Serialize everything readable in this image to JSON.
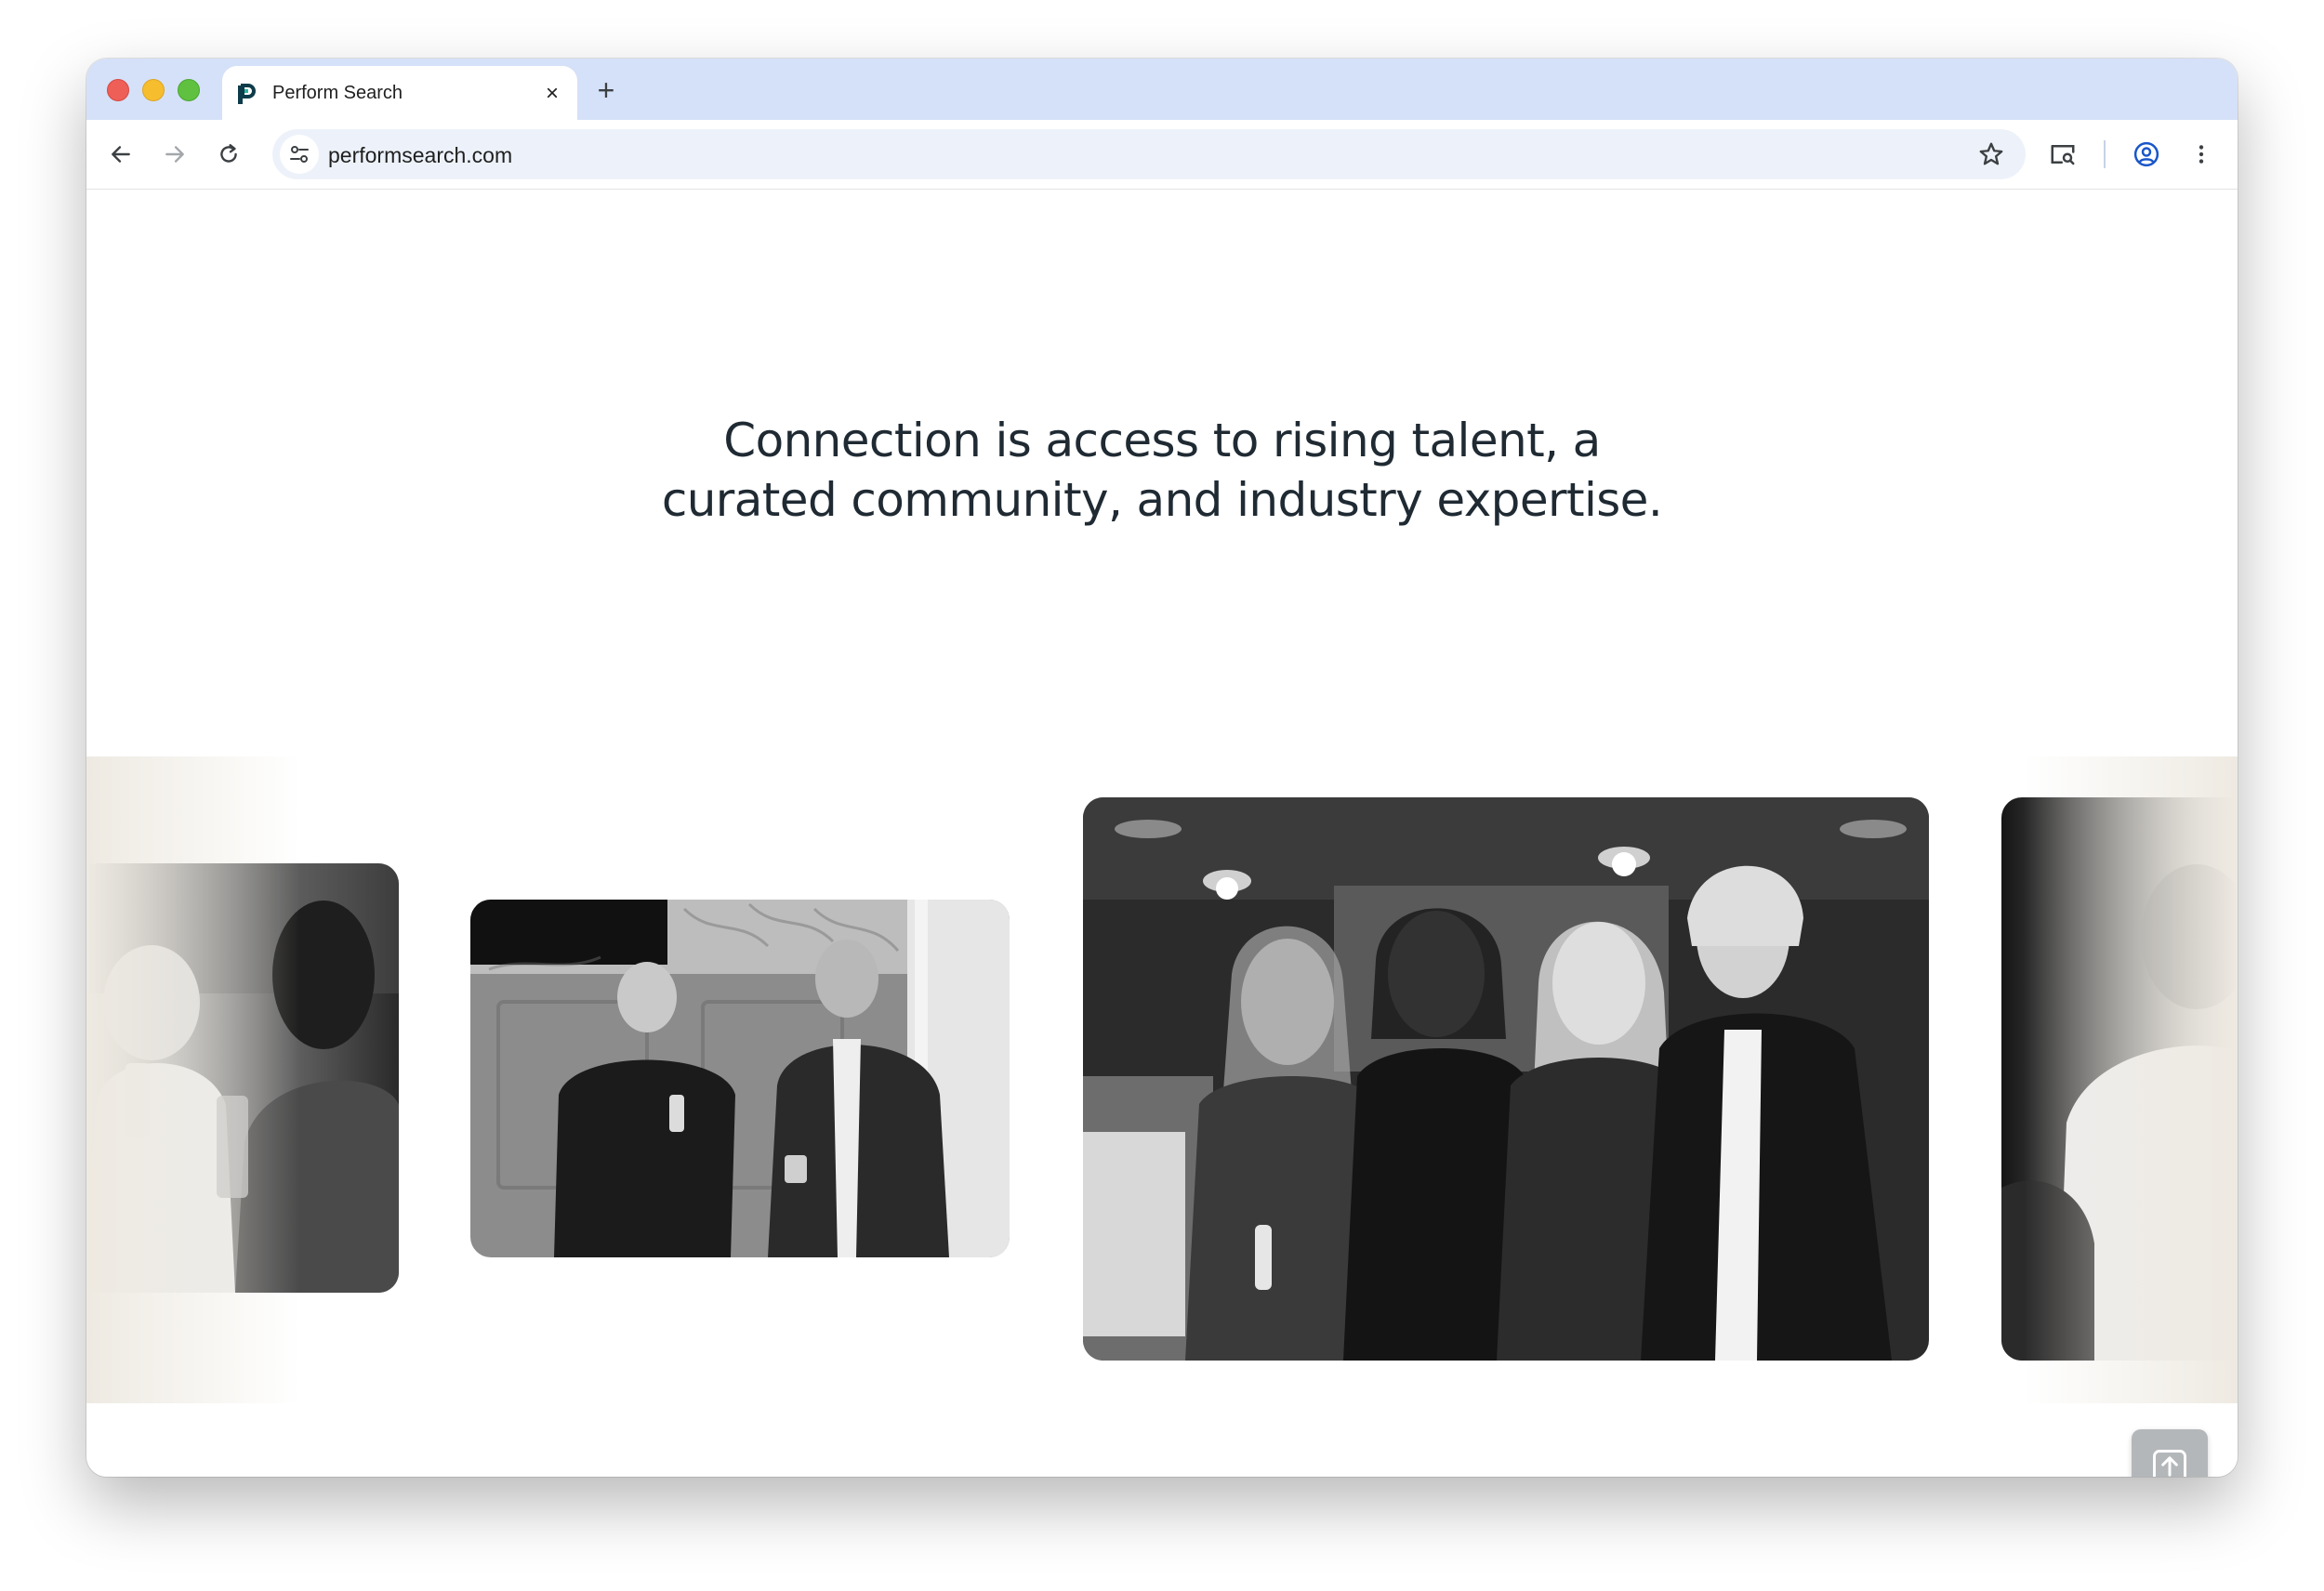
{
  "browser": {
    "tab_title": "Perform Search",
    "tab_close": "×",
    "new_tab": "+",
    "url": "performsearch.com"
  },
  "page": {
    "headline_line1": "Connection is access to rising talent, a",
    "headline_line2": "curated community, and industry expertise."
  },
  "gallery": {
    "photos": [
      {
        "alt": "Two women laughing holding drinks"
      },
      {
        "alt": "Two men laughing holding drinks"
      },
      {
        "alt": "Four women posing together at an event"
      },
      {
        "alt": "Man in white shirt seated"
      }
    ]
  },
  "icons": {
    "back": "arrow-left-icon",
    "forward": "arrow-right-icon",
    "reload": "reload-icon",
    "site_info": "tune-icon",
    "bookmark": "star-icon",
    "tab_search": "tab-search-icon",
    "profile": "profile-icon",
    "menu": "kebab-menu-icon",
    "scroll_top": "arrow-up-icon"
  },
  "colors": {
    "tabstrip": "#d5e1f8",
    "omnibox": "#edf2fa",
    "headline": "#1f2a33",
    "band_fade": "#eeeae2",
    "scroll_top_button": "#b4b7ba"
  }
}
